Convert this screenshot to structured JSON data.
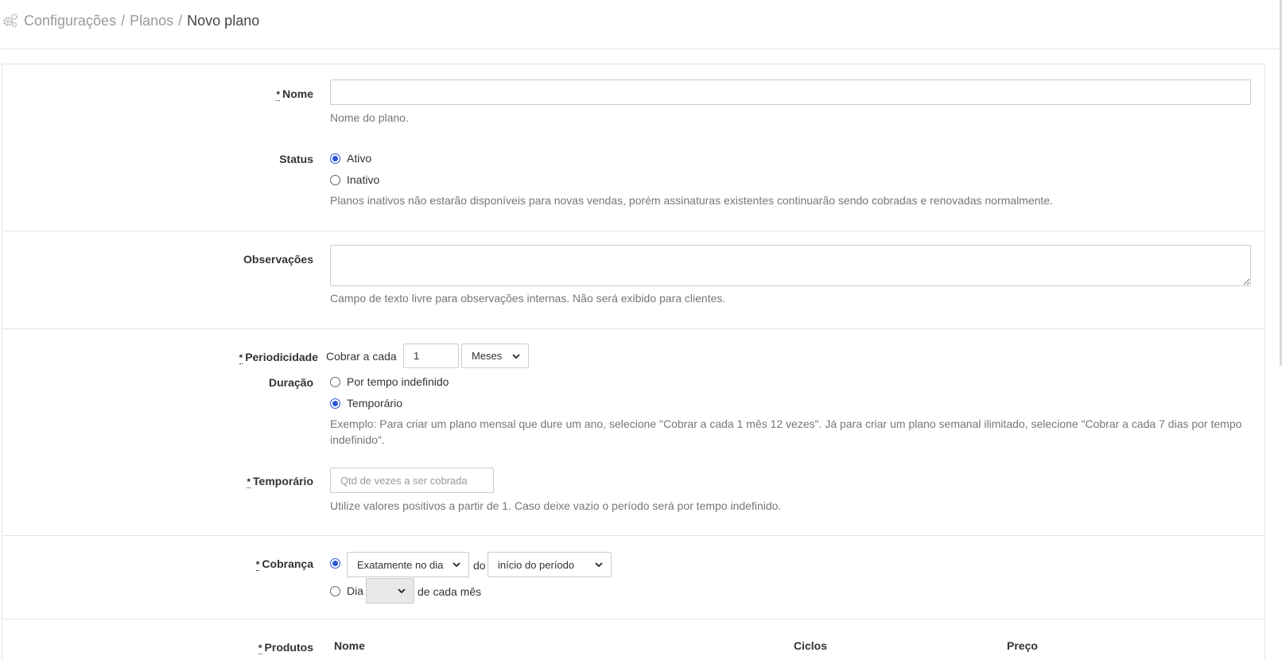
{
  "breadcrumb": {
    "items": [
      "Configurações",
      "Planos"
    ],
    "current": "Novo plano",
    "separator": "/"
  },
  "form": {
    "nome": {
      "required_mark": "*",
      "label": "Nome",
      "value": "",
      "help": "Nome do plano."
    },
    "status": {
      "label": "Status",
      "options": [
        {
          "label": "Ativo",
          "selected": true
        },
        {
          "label": "Inativo",
          "selected": false
        }
      ],
      "help": "Planos inativos não estarão disponíveis para novas vendas, porém assinaturas existentes continuarão sendo cobradas e renovadas normalmente."
    },
    "observacoes": {
      "label": "Observações",
      "value": "",
      "help": "Campo de texto livre para observações internas. Não será exibido para clientes."
    },
    "periodicidade": {
      "required_mark": "*",
      "label": "Periodicidade",
      "prefix": "Cobrar a cada",
      "value": "1",
      "unit": "Meses"
    },
    "duracao": {
      "label": "Duração",
      "options": [
        {
          "label": "Por tempo indefinido",
          "selected": false
        },
        {
          "label": "Temporário",
          "selected": true
        }
      ],
      "help": "Exemplo: Para criar um plano mensal que dure um ano, selecione \"Cobrar a cada 1 mês 12 vezes\". Já para criar um plano semanal ilimitado, selecione \"Cobrar a cada 7 dias por tempo indefinido\"."
    },
    "temporario": {
      "required_mark": "*",
      "label": "Temporário",
      "placeholder": "Qtd de vezes a ser cobrada",
      "help": "Utilize valores positivos a partir de 1. Caso deixe vazio o período será por tempo indefinido."
    },
    "cobranca": {
      "required_mark": "*",
      "label": "Cobrança",
      "mode": "Exatamente no dia",
      "connector": "do",
      "reference": "início do período",
      "alt_prefix": "Dia",
      "alt_value": "",
      "alt_suffix": "de cada mês"
    },
    "produtos": {
      "required_mark": "*",
      "label": "Produtos",
      "columns": [
        "Nome",
        "Ciclos",
        "Preço"
      ]
    }
  },
  "colors": {
    "accent": "#2c55d8",
    "border": "#cccccc",
    "help": "#777777"
  },
  "icons": {
    "breadcrumb": "gears-icon"
  }
}
